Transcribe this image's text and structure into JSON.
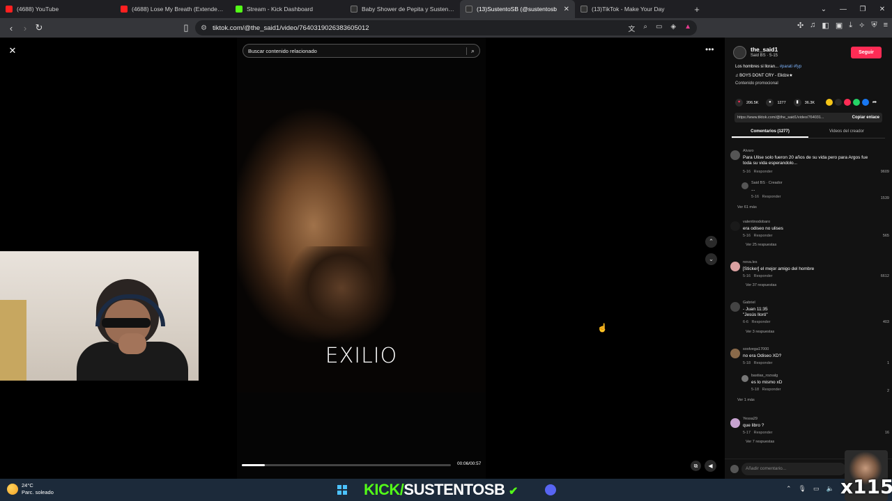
{
  "browser": {
    "tabs": [
      {
        "label": "(4688) YouTube",
        "color": "#ff2020"
      },
      {
        "label": "(4688) Lose My Breath (Extended Mix",
        "color": "#ff2020"
      },
      {
        "label": "Stream - Kick Dashboard",
        "color": "#53fc18"
      },
      {
        "label": "Baby Shower de Pepita y Sustento: M",
        "color": "#000000"
      },
      {
        "label": "(13)SustentoSB (@sustentosb",
        "color": "#000000",
        "active": true
      },
      {
        "label": "(13)TikTok - Make Your Day",
        "color": "#000000"
      }
    ],
    "url": "tiktok.com/@the_said1/video/7640319026383605012"
  },
  "video": {
    "search_placeholder": "Buscar contenido relacionado",
    "overlay_text": "EXILIO",
    "time": "00:06/00:57",
    "progress": 0.11
  },
  "panel": {
    "username": "the_said1",
    "subline": "Said BS  ·  5-15",
    "follow": "Seguir",
    "description": "Los hombres si lloran... ",
    "hashtags": "#parati  #fyp",
    "song": "♫  BOYS DONT CRY - Elidze★",
    "promo": "Contenido promocional",
    "likes": "206.5K",
    "comments_count": "1277",
    "saves": "36.3K",
    "link": "https://www.tiktok.com/@the_said1/video/764031...",
    "copy_link": "Copiar enlace",
    "tab_comments": "Comentarios (1277)",
    "tab_videos": "Videos del creador",
    "add_comment": "Añadir comentario..."
  },
  "comments": [
    {
      "user": "Alvaro",
      "text": "Para Ulise solo fueron 20 años de su vida pero para Argos fue toda su vida esperandolo...",
      "date": "5-16",
      "reply": "Responder",
      "likes": "9609"
    },
    {
      "user": "Said BS  ·  Creador",
      "text": "...",
      "date": "5-16",
      "reply": "Responder",
      "likes": "1539",
      "more": "Ver 61 más"
    },
    {
      "user": "valentinodobaro",
      "text": "era odiseo no ulises",
      "date": "5-16",
      "reply": "Responder",
      "likes": "565",
      "more": "Ver 25 respuestas"
    },
    {
      "user": "nova.les",
      "text": "[Sticker] el mejor amigo del hombre",
      "date": "5-16",
      "reply": "Responder",
      "likes": "6612",
      "more": "Ver 37 respuestas"
    },
    {
      "user": "Gabriel",
      "text": "- Juan 11:35\n\"Jesús lloró\"",
      "date": "6-6",
      "reply": "Responder",
      "likes": "403",
      "more": "Ver 3 respuestas"
    },
    {
      "user": "soolvega17000",
      "text": "no era Odiseo XD?",
      "date": "5-18",
      "reply": "Responder",
      "likes": "1"
    },
    {
      "user": "bastias_rozsalg",
      "text": "es lo mismo xD",
      "date": "5-18",
      "reply": "Responder",
      "likes": "2",
      "more": "Ver 1 más"
    },
    {
      "user": "Yessa29",
      "text": "que libro ?",
      "date": "5-17",
      "reply": "Responder",
      "likes": "16",
      "more": "Ver 7 respuestas"
    }
  ],
  "taskbar": {
    "temp": "24°C",
    "weather": "Parc. soleado",
    "kick_prefix": "KICK/",
    "kick_channel": "SUSTENTOSB",
    "badge": "x115"
  }
}
